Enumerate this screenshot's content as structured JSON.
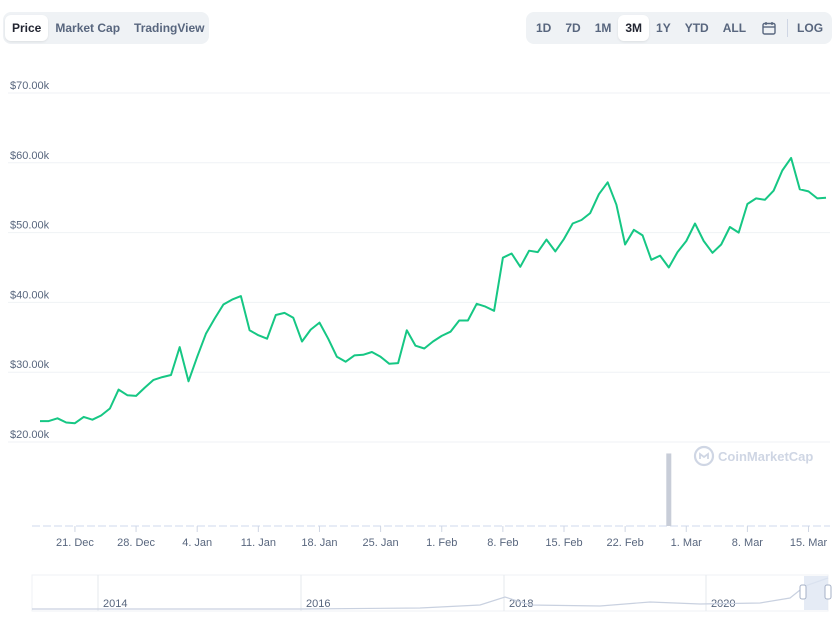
{
  "tabs": [
    {
      "label": "Price",
      "active": true
    },
    {
      "label": "Market Cap",
      "active": false
    },
    {
      "label": "TradingView",
      "active": false
    }
  ],
  "ranges": [
    {
      "label": "1D",
      "active": false
    },
    {
      "label": "7D",
      "active": false
    },
    {
      "label": "1M",
      "active": false
    },
    {
      "label": "3M",
      "active": true
    },
    {
      "label": "1Y",
      "active": false
    },
    {
      "label": "YTD",
      "active": false
    },
    {
      "label": "ALL",
      "active": false
    }
  ],
  "calendar_icon": "calendar-icon",
  "log_label": "LOG",
  "watermark": "CoinMarketCap",
  "colors": {
    "line": "#16c784",
    "volume": "#c8cdd8",
    "grid": "#eff2f5",
    "navigator_fill": "#dfe6f3",
    "handle": "#a6b1c7"
  },
  "chart_data": {
    "type": "line",
    "title": "",
    "xlabel": "",
    "ylabel": "",
    "ylim": [
      20000,
      70000
    ],
    "y_ticks": [
      {
        "value": 70000,
        "label": "$70.00k"
      },
      {
        "value": 60000,
        "label": "$60.00k"
      },
      {
        "value": 50000,
        "label": "$50.00k"
      },
      {
        "value": 40000,
        "label": "$40.00k"
      },
      {
        "value": 30000,
        "label": "$30.00k"
      },
      {
        "value": 20000,
        "label": "$20.00k"
      }
    ],
    "x_ticks": [
      {
        "day": 4,
        "label": "21. Dec"
      },
      {
        "day": 11,
        "label": "28. Dec"
      },
      {
        "day": 18,
        "label": "4. Jan"
      },
      {
        "day": 25,
        "label": "11. Jan"
      },
      {
        "day": 32,
        "label": "18. Jan"
      },
      {
        "day": 39,
        "label": "25. Jan"
      },
      {
        "day": 46,
        "label": "1. Feb"
      },
      {
        "day": 53,
        "label": "8. Feb"
      },
      {
        "day": 60,
        "label": "15. Feb"
      },
      {
        "day": 67,
        "label": "22. Feb"
      },
      {
        "day": 74,
        "label": "1. Mar"
      },
      {
        "day": 81,
        "label": "8. Mar"
      },
      {
        "day": 88,
        "label": "15. Mar"
      }
    ],
    "x_range": [
      0,
      90
    ],
    "series": [
      {
        "days": [
          0,
          1,
          2,
          3,
          4,
          5,
          6,
          7,
          8,
          9,
          10,
          11,
          12,
          13,
          14,
          15,
          16,
          17,
          18,
          19,
          20,
          21,
          22,
          23,
          24,
          25,
          26,
          27,
          28,
          29,
          30,
          31,
          32,
          33,
          34,
          35,
          36,
          37,
          38,
          39,
          40,
          41,
          42,
          43,
          44,
          45,
          46,
          47,
          48,
          49,
          50,
          51,
          52,
          53,
          54,
          55,
          56,
          57,
          58,
          59,
          60,
          61,
          62,
          63,
          64,
          65,
          66,
          67,
          68,
          69,
          70,
          71,
          72,
          73,
          74,
          75,
          76,
          77,
          78,
          79,
          80,
          81,
          82,
          83,
          84,
          85,
          86,
          87,
          88,
          89,
          90
        ],
        "values": [
          23000,
          23000,
          23400,
          22800,
          22700,
          23600,
          23200,
          23800,
          24800,
          27500,
          26700,
          26600,
          27800,
          28900,
          29300,
          29600,
          33600,
          28700,
          32200,
          35500,
          37700,
          39700,
          40400,
          40900,
          36000,
          35300,
          34800,
          38200,
          38500,
          37800,
          34400,
          36100,
          37100,
          34800,
          32200,
          31500,
          32400,
          32500,
          32900,
          32200,
          31200,
          31300,
          36000,
          33800,
          33400,
          34400,
          35200,
          35800,
          37400,
          37400,
          39800,
          39400,
          38800,
          46400,
          47000,
          45100,
          47400,
          47200,
          49000,
          47300,
          49100,
          51300,
          51800,
          52800,
          55500,
          57200,
          54000,
          48300,
          50400,
          49600,
          46100,
          46700,
          45000,
          47200,
          48800,
          51300,
          48800,
          47100,
          48300,
          50800,
          50000,
          54100,
          54900,
          54700,
          56000,
          58900,
          60700,
          56200,
          55900,
          54900,
          55000
        ]
      }
    ],
    "volume": {
      "day": 72,
      "relative_height": 0.93
    },
    "navigator_labels": [
      "2014",
      "2016",
      "2018",
      "2020"
    ]
  }
}
